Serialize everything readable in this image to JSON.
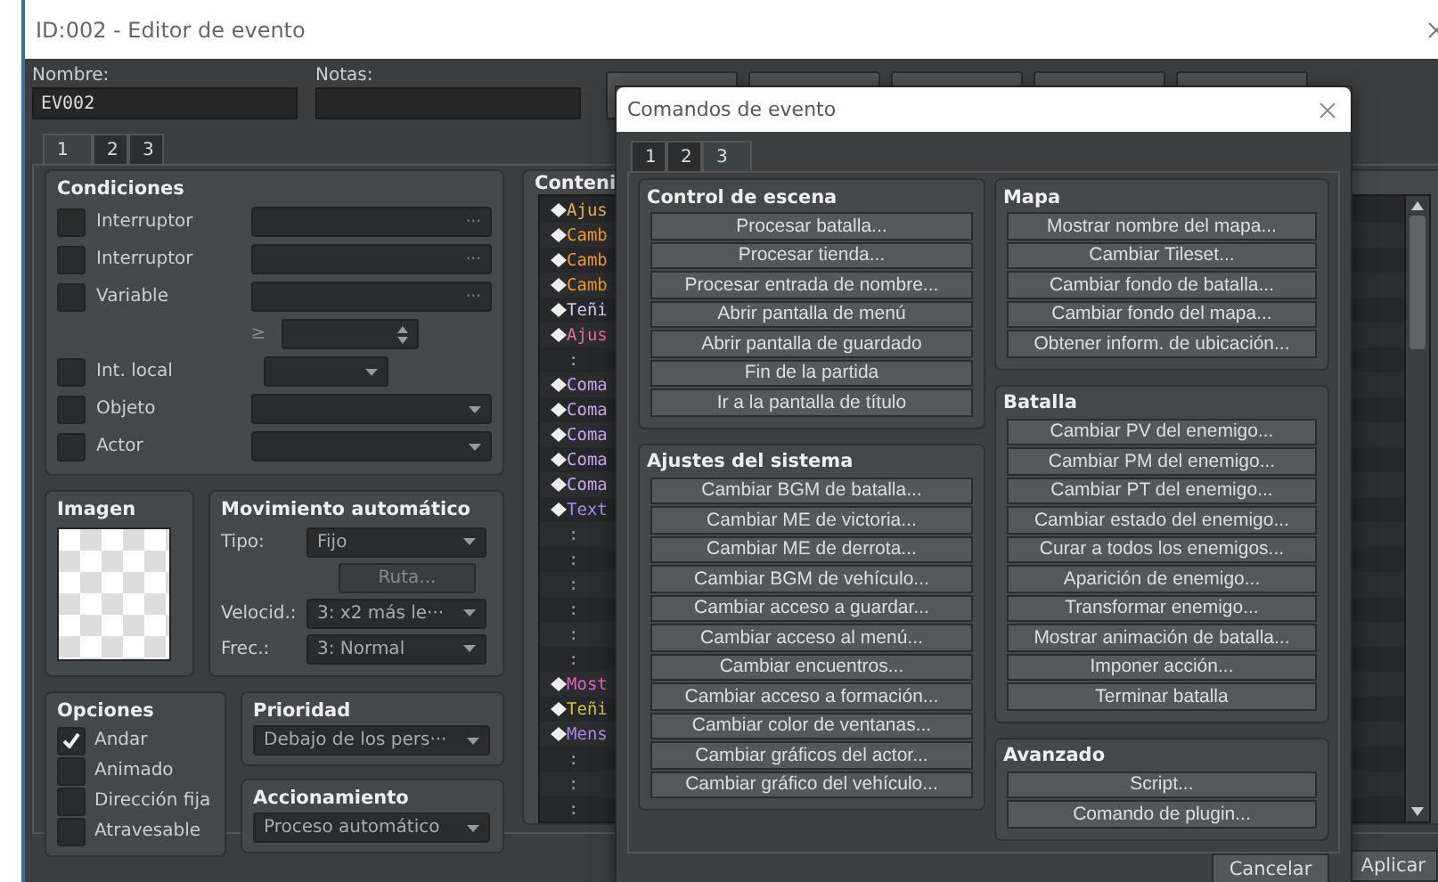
{
  "window": {
    "title": "ID:002 - Editor de evento"
  },
  "name": {
    "label": "Nombre:",
    "value": "EV002"
  },
  "notes": {
    "label": "Notas:"
  },
  "tabs": [
    {
      "label": "1",
      "selected": true
    },
    {
      "label": "2",
      "selected": false
    },
    {
      "label": "3",
      "selected": false
    }
  ],
  "conditions": {
    "title": "Condiciones",
    "rows": [
      {
        "kind": "picker",
        "label": "Interruptor",
        "checked": false,
        "button": "···"
      },
      {
        "kind": "picker",
        "label": "Interruptor",
        "checked": false,
        "button": "···"
      },
      {
        "kind": "variable",
        "label": "Variable",
        "checked": false,
        "button": "···",
        "operator": "≥"
      },
      {
        "kind": "select_short",
        "label": "Int. local",
        "checked": false
      },
      {
        "kind": "select",
        "label": "Objeto",
        "checked": false
      },
      {
        "kind": "select",
        "label": "Actor",
        "checked": false
      }
    ]
  },
  "image": {
    "title": "Imagen"
  },
  "movement": {
    "title": "Movimiento automático",
    "fields": [
      {
        "kind": "select",
        "label": "Tipo:",
        "value": "Fijo"
      },
      {
        "kind": "button",
        "value": "Ruta...",
        "disabled": true
      },
      {
        "kind": "select",
        "label": "Velocid.:",
        "value": "3: x2 más le···"
      },
      {
        "kind": "select",
        "label": "Frec.:",
        "value": "3: Normal"
      }
    ]
  },
  "options": {
    "title": "Opciones",
    "items": [
      {
        "label": "Andar",
        "checked": true
      },
      {
        "label": "Animado",
        "checked": false
      },
      {
        "label": "Dirección fija",
        "checked": false
      },
      {
        "label": "Atravesable",
        "checked": false
      }
    ]
  },
  "priority": {
    "title": "Prioridad",
    "value": "Debajo de los pers···"
  },
  "trigger": {
    "title": "Accionamiento",
    "value": "Proceso automático"
  },
  "contents": {
    "title": "Conteni",
    "rows": [
      {
        "kind": "command",
        "text": "Ajus",
        "color": "#e8b048"
      },
      {
        "kind": "command",
        "text": "Camb",
        "color": "#f09a28"
      },
      {
        "kind": "command",
        "text": "Camb",
        "color": "#f09a28"
      },
      {
        "kind": "command",
        "text": "Camb",
        "color": "#f09a28"
      },
      {
        "kind": "command",
        "text": "Teñi",
        "color": "#d8c8f0"
      },
      {
        "kind": "command",
        "text": "Ajus",
        "color": "#e07098"
      },
      {
        "kind": "blank",
        "text": ":",
        "color": "#9a9a9a"
      },
      {
        "kind": "command",
        "text": "Coma",
        "color": "#c8a8f0"
      },
      {
        "kind": "command",
        "text": "Coma",
        "color": "#c8a8f0"
      },
      {
        "kind": "command",
        "text": "Coma",
        "color": "#c8a8f0"
      },
      {
        "kind": "command",
        "text": "Coma",
        "color": "#c8a8f0"
      },
      {
        "kind": "command",
        "text": "Coma",
        "color": "#c8a8f0"
      },
      {
        "kind": "command",
        "text": "Text",
        "color": "#a888f0"
      },
      {
        "kind": "blank",
        "text": ":",
        "color": "#9a9a9a"
      },
      {
        "kind": "blank",
        "text": ":",
        "color": "#9a9a9a"
      },
      {
        "kind": "blank",
        "text": ":",
        "color": "#9a9a9a"
      },
      {
        "kind": "blank",
        "text": ":",
        "color": "#9a9a9a"
      },
      {
        "kind": "blank",
        "text": ":",
        "color": "#9a9a9a"
      },
      {
        "kind": "blank",
        "text": ":",
        "color": "#9a9a9a"
      },
      {
        "kind": "command",
        "text": "Most",
        "color": "#e060c0"
      },
      {
        "kind": "command",
        "text": "Teñi",
        "color": "#d8c040"
      },
      {
        "kind": "command",
        "text": "Mens",
        "color": "#a888f0"
      },
      {
        "kind": "blank",
        "text": ":",
        "color": "#9a9a9a"
      },
      {
        "kind": "blank",
        "text": ":",
        "color": "#9a9a9a"
      },
      {
        "kind": "blank",
        "text": ":",
        "color": "#9a9a9a"
      }
    ]
  },
  "apply_button": "Aplicar",
  "dialog": {
    "title": "Comandos de evento",
    "tabs": [
      {
        "label": "1",
        "selected": false
      },
      {
        "label": "2",
        "selected": false
      },
      {
        "label": "3",
        "selected": true
      }
    ],
    "columns": [
      [
        {
          "title": "Control de escena",
          "buttons": [
            "Procesar batalla...",
            "Procesar tienda...",
            "Procesar entrada de nombre...",
            "Abrir pantalla de menú",
            "Abrir pantalla de guardado",
            "Fin de la partida",
            "Ir a la pantalla de título"
          ]
        },
        {
          "title": "Ajustes del sistema",
          "buttons": [
            "Cambiar BGM de batalla...",
            "Cambiar ME de victoria...",
            "Cambiar ME de derrota...",
            "Cambiar BGM de vehículo...",
            "Cambiar acceso a guardar...",
            "Cambiar acceso al menú...",
            "Cambiar encuentros...",
            "Cambiar acceso a formación...",
            "Cambiar color de ventanas...",
            "Cambiar gráficos del actor...",
            "Cambiar gráfico del vehículo..."
          ]
        }
      ],
      [
        {
          "title": "Mapa",
          "buttons": [
            "Mostrar nombre del mapa...",
            "Cambiar Tileset...",
            "Cambiar fondo de batalla...",
            "Cambiar fondo del mapa...",
            "Obtener inform. de ubicación..."
          ]
        },
        {
          "title": "Batalla",
          "buttons": [
            "Cambiar PV del enemigo...",
            "Cambiar PM del enemigo...",
            "Cambiar PT del enemigo...",
            "Cambiar estado del enemigo...",
            "Curar a todos los enemigos...",
            "Aparición de enemigo...",
            "Transformar enemigo...",
            "Mostrar animación de batalla...",
            "Imponer acción...",
            "Terminar batalla"
          ]
        },
        {
          "title": "Avanzado",
          "buttons": [
            "Script...",
            "Comando de plugin..."
          ]
        }
      ]
    ],
    "cancel_button": "Cancelar"
  }
}
